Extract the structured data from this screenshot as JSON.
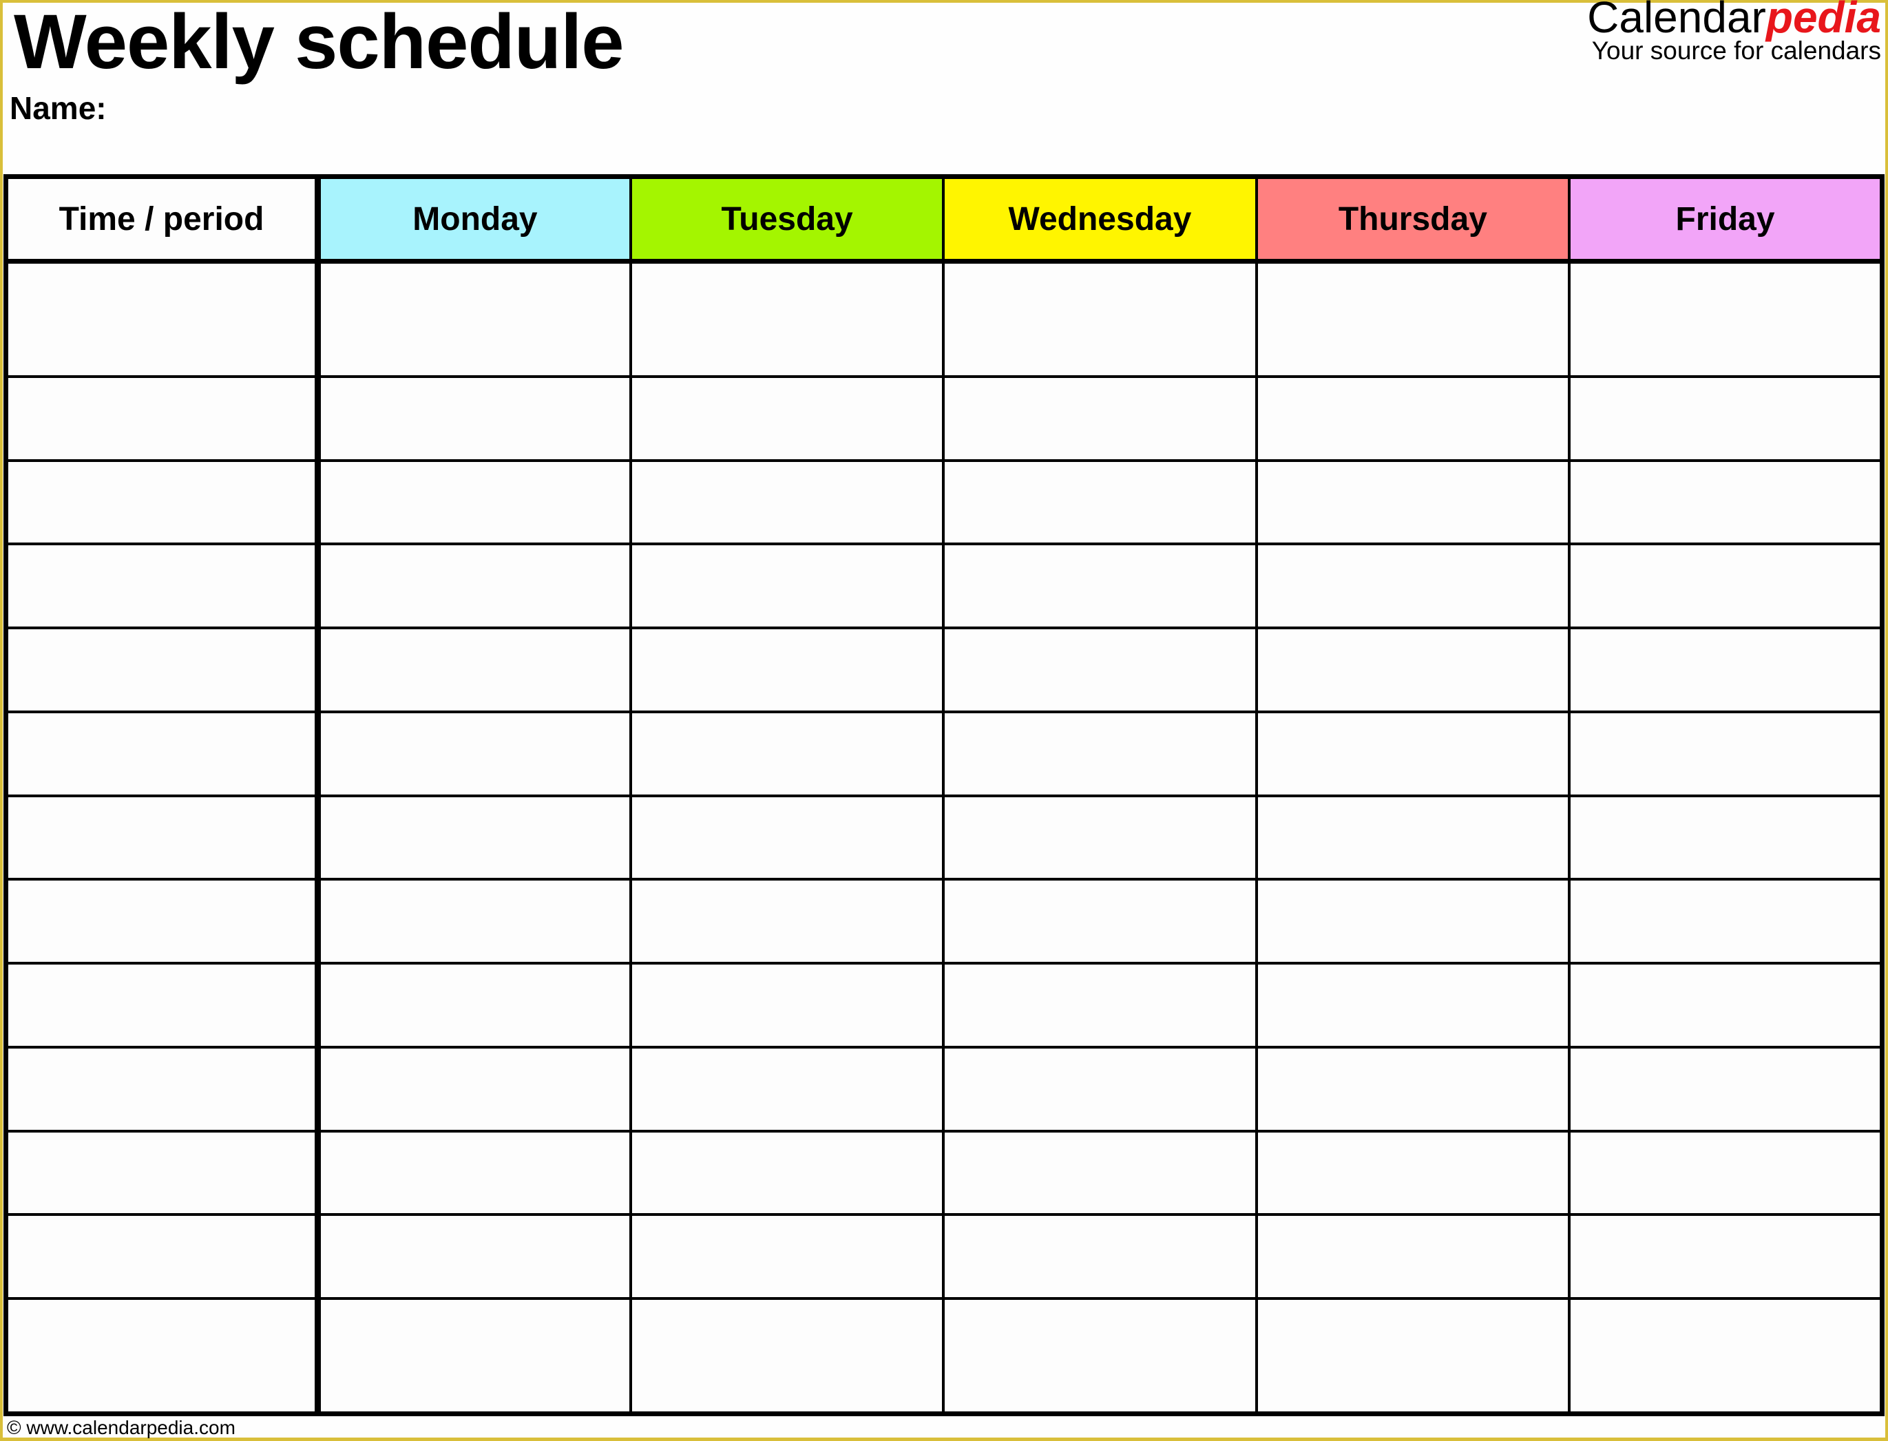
{
  "header": {
    "title": "Weekly schedule",
    "name_label": "Name:"
  },
  "logo": {
    "brand_plain": "Calendar",
    "brand_accent": "pedia",
    "tagline": "Your source for calendars",
    "accent_color": "#e8161b"
  },
  "table": {
    "columns": [
      {
        "label": "Time / period",
        "color": "#fdfdfd"
      },
      {
        "label": "Monday",
        "color": "#a8f3fd"
      },
      {
        "label": "Tuesday",
        "color": "#a4f500"
      },
      {
        "label": "Wednesday",
        "color": "#fff500"
      },
      {
        "label": "Thursday",
        "color": "#ff8080"
      },
      {
        "label": "Friday",
        "color": "#f2a5f8"
      }
    ],
    "row_count": 13,
    "rows": [
      [
        "",
        "",
        "",
        "",
        "",
        ""
      ],
      [
        "",
        "",
        "",
        "",
        "",
        ""
      ],
      [
        "",
        "",
        "",
        "",
        "",
        ""
      ],
      [
        "",
        "",
        "",
        "",
        "",
        ""
      ],
      [
        "",
        "",
        "",
        "",
        "",
        ""
      ],
      [
        "",
        "",
        "",
        "",
        "",
        ""
      ],
      [
        "",
        "",
        "",
        "",
        "",
        ""
      ],
      [
        "",
        "",
        "",
        "",
        "",
        ""
      ],
      [
        "",
        "",
        "",
        "",
        "",
        ""
      ],
      [
        "",
        "",
        "",
        "",
        "",
        ""
      ],
      [
        "",
        "",
        "",
        "",
        "",
        ""
      ],
      [
        "",
        "",
        "",
        "",
        "",
        ""
      ],
      [
        "",
        "",
        "",
        "",
        "",
        ""
      ]
    ]
  },
  "footer": {
    "copyright": "© www.calendarpedia.com"
  }
}
